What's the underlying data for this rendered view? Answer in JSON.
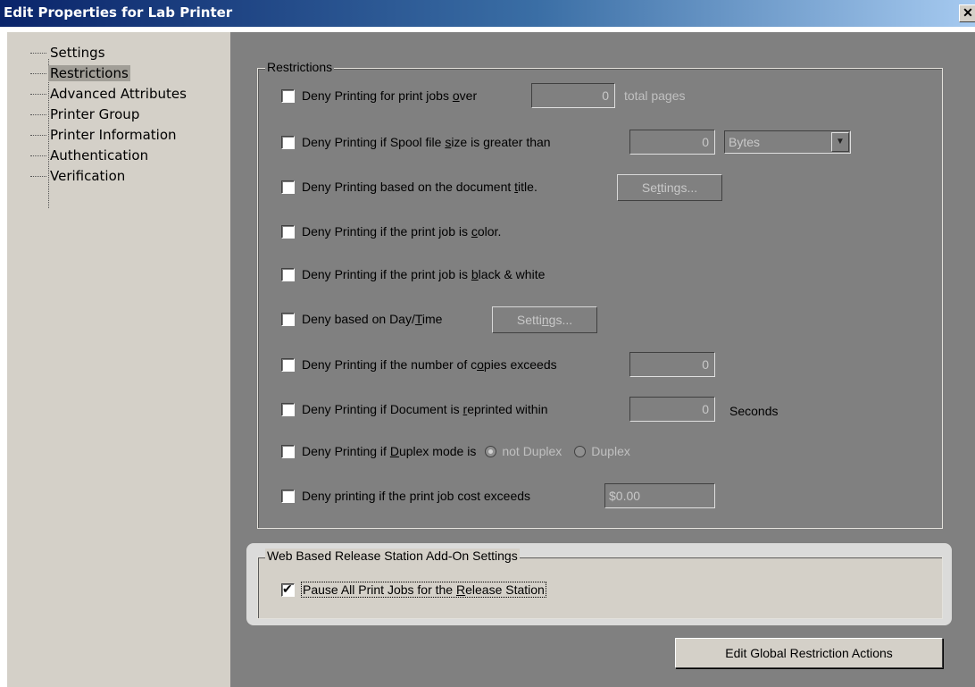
{
  "window": {
    "title": "Edit Properties for Lab Printer",
    "close_glyph": "✕"
  },
  "tree": {
    "items": [
      {
        "label": "Settings",
        "selected": false
      },
      {
        "label": "Restrictions",
        "selected": true
      },
      {
        "label": "Advanced Attributes",
        "selected": false
      },
      {
        "label": "Printer Group",
        "selected": false
      },
      {
        "label": "Printer Information",
        "selected": false
      },
      {
        "label": "Authentication",
        "selected": false
      },
      {
        "label": "Verification",
        "selected": false
      }
    ]
  },
  "restrictions": {
    "group_title": "Restrictions",
    "pages": {
      "pre": "Deny Printing for print jobs ",
      "key": "o",
      "post": "ver",
      "value": "0",
      "unit": "total pages",
      "checked": false
    },
    "spool": {
      "pre": "Deny Printing if Spool file ",
      "key": "s",
      "post": "ize is greater than",
      "value": "0",
      "unit_selected": "Bytes",
      "checked": false
    },
    "title": {
      "pre": "Deny Printing based on the document ",
      "key": "t",
      "post": "itle.",
      "button_pre": "Se",
      "button_key": "t",
      "button_post": "tings...",
      "checked": false
    },
    "color": {
      "pre": "Deny Printing if the print job is ",
      "key": "c",
      "post": "olor.",
      "checked": false
    },
    "bw": {
      "pre": "Deny Printing if the print job is ",
      "key": "b",
      "post": "lack & white",
      "checked": false
    },
    "daytime": {
      "pre": "Deny based on Day/",
      "key": "T",
      "post": "ime",
      "button_pre": "Setti",
      "button_key": "n",
      "button_post": "gs...",
      "checked": false
    },
    "copies": {
      "pre": "Deny Printing if the number of c",
      "key": "o",
      "post": "pies exceeds",
      "value": "0",
      "checked": false
    },
    "reprint": {
      "pre": "Deny Printing if Document is ",
      "key": "r",
      "post": "eprinted within",
      "value": "0",
      "unit": "Seconds",
      "checked": false
    },
    "duplex": {
      "pre": "Deny Printing if ",
      "key": "D",
      "post": "uplex mode is",
      "opt1": "not Duplex",
      "opt2": "Duplex",
      "checked": false
    },
    "cost": {
      "label": "Deny printing if the print job cost exceeds",
      "value": "$0.00",
      "checked": false
    }
  },
  "websrs": {
    "group_title": "Web Based Release Station Add-On Settings",
    "pause_pre": "Pause All Print Jobs for the ",
    "pause_key": "R",
    "pause_post": "elease Station",
    "pause_checked": true
  },
  "actions": {
    "edit_global": "Edit Global Restriction Actions"
  },
  "colors": {
    "title_bar_start": "#0a246a",
    "title_bar_end": "#a6caf0",
    "dialog_face": "#d4d0c8",
    "disabled_area": "#808080",
    "selected_item": "#a19e97"
  },
  "icons": {
    "close": "close-icon",
    "dropdown": "chevron-down-icon",
    "tree_connector": "dotted-line"
  }
}
